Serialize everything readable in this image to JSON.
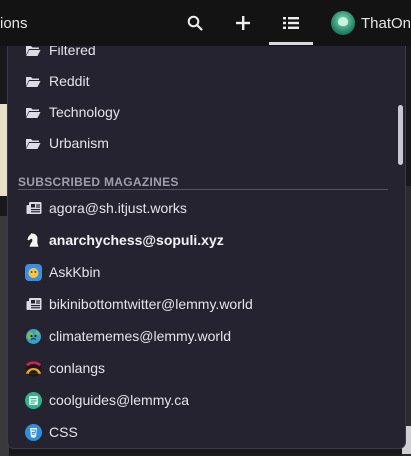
{
  "nav": {
    "partial_link": "ions",
    "user_name": "ThatOne"
  },
  "dropdown": {
    "folders": [
      {
        "label": "Filtered",
        "icon": "folder-icon"
      },
      {
        "label": "Reddit",
        "icon": "folder-icon"
      },
      {
        "label": "Technology",
        "icon": "folder-icon"
      },
      {
        "label": "Urbanism",
        "icon": "folder-icon"
      }
    ],
    "section_title": "SUBSCRIBED MAGAZINES",
    "magazines": [
      {
        "label": "agora@sh.itjust.works",
        "icon": "newspaper-icon"
      },
      {
        "label": "anarchychess@sopuli.xyz",
        "icon": "chess-knight-icon"
      },
      {
        "label": "AskKbin",
        "icon": "askkbin-logo-icon"
      },
      {
        "label": "bikinibottomtwitter@lemmy.world",
        "icon": "newspaper-icon"
      },
      {
        "label": "climatememes@lemmy.world",
        "icon": "globe-face-icon"
      },
      {
        "label": "conlangs",
        "icon": "conlangs-logo-icon"
      },
      {
        "label": "coolguides@lemmy.ca",
        "icon": "coolguides-logo-icon"
      },
      {
        "label": "CSS",
        "icon": "css-logo-icon"
      }
    ]
  },
  "colors": {
    "panel_bg": "#25232f",
    "topbar_bg": "#131314",
    "accent_divider": "#555364"
  }
}
